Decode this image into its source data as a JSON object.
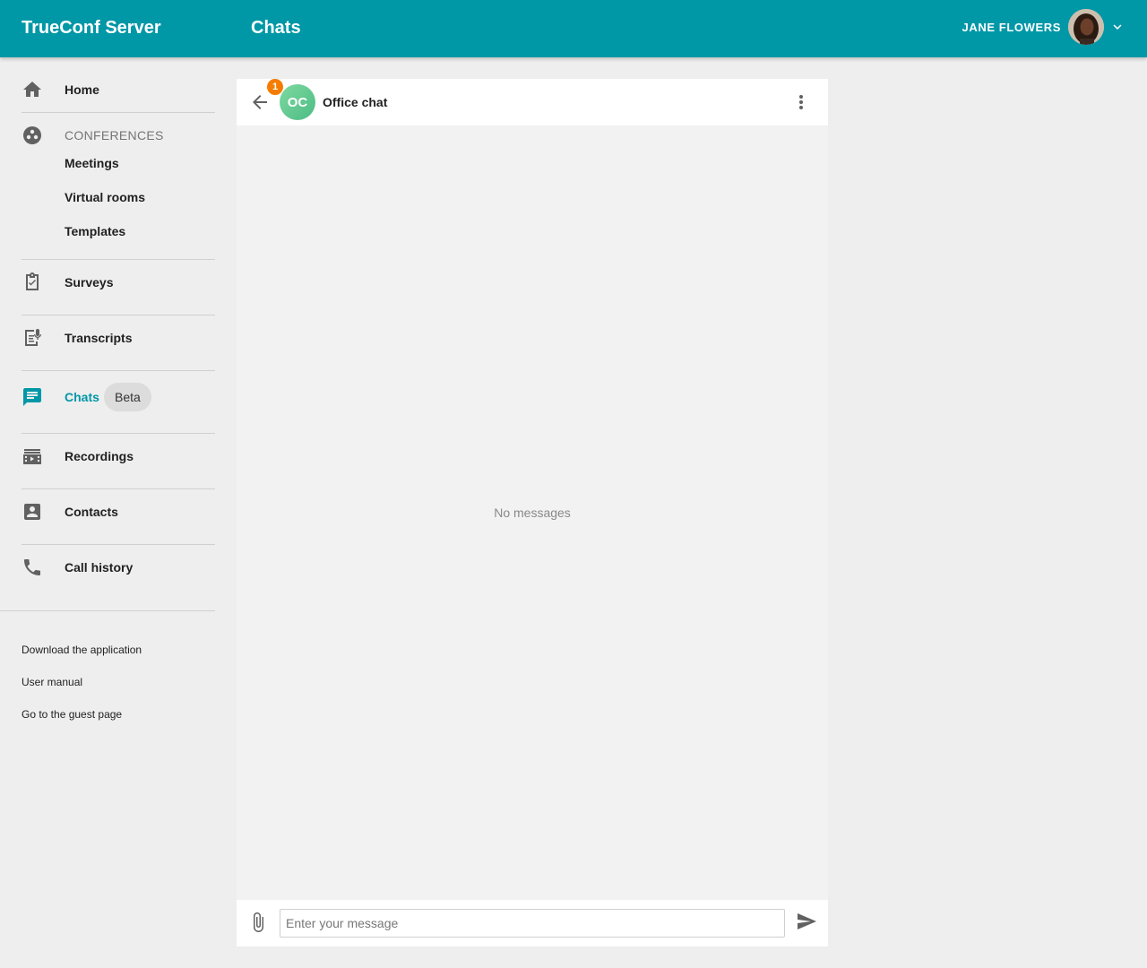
{
  "header": {
    "app_title": "TrueConf Server",
    "page_title": "Chats",
    "user_name": "JANE FLOWERS",
    "brand_color": "#0097a7"
  },
  "sidebar": {
    "home": "Home",
    "conferences_title": "CONFERENCES",
    "conference_items": [
      "Meetings",
      "Virtual rooms",
      "Templates"
    ],
    "surveys": "Surveys",
    "transcripts": "Transcripts",
    "chats": "Chats",
    "chats_badge": "Beta",
    "recordings": "Recordings",
    "contacts": "Contacts",
    "call_history": "Call history",
    "footer_links": [
      "Download the application",
      "User manual",
      "Go to the guest page"
    ]
  },
  "chat": {
    "avatar_initials": "OC",
    "unread_count": "1",
    "unread_color": "#f57c00",
    "name": "Office chat",
    "empty_text": "No messages",
    "input_placeholder": "Enter your message",
    "input_value": ""
  },
  "icons": {
    "home": "home-icon",
    "conferences": "group-icon",
    "surveys": "clipboard-check-icon",
    "transcripts": "transcript-icon",
    "chats": "chat-icon",
    "recordings": "recordings-icon",
    "contacts": "contact-card-icon",
    "call_history": "phone-icon",
    "back": "arrow-back-icon",
    "more": "more-vert-icon",
    "attach": "paperclip-icon",
    "send": "send-icon"
  }
}
